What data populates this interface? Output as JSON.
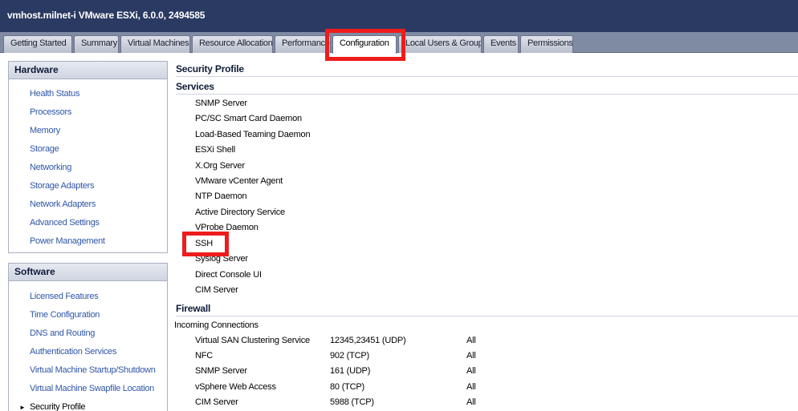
{
  "window": {
    "title": "vmhost.milnet-i VMware ESXi, 6.0.0, 2494585"
  },
  "tabs": [
    {
      "label": "Getting Started"
    },
    {
      "label": "Summary"
    },
    {
      "label": "Virtual Machines"
    },
    {
      "label": "Resource Allocation"
    },
    {
      "label": "Performance"
    },
    {
      "label": "Configuration"
    },
    {
      "label": "Local Users & Groups"
    },
    {
      "label": "Events"
    },
    {
      "label": "Permissions"
    }
  ],
  "active_tab": "Configuration",
  "hardware": {
    "header": "Hardware",
    "items": [
      {
        "label": "Health Status"
      },
      {
        "label": "Processors"
      },
      {
        "label": "Memory"
      },
      {
        "label": "Storage"
      },
      {
        "label": "Networking"
      },
      {
        "label": "Storage Adapters"
      },
      {
        "label": "Network Adapters"
      },
      {
        "label": "Advanced Settings"
      },
      {
        "label": "Power Management"
      }
    ]
  },
  "software": {
    "header": "Software",
    "items": [
      {
        "label": "Licensed Features"
      },
      {
        "label": "Time Configuration"
      },
      {
        "label": "DNS and Routing"
      },
      {
        "label": "Authentication Services"
      },
      {
        "label": "Virtual Machine Startup/Shutdown"
      },
      {
        "label": "Virtual Machine Swapfile Location"
      },
      {
        "label": "Security Profile"
      }
    ]
  },
  "main": {
    "title": "Security Profile",
    "services_heading": "Services",
    "services": [
      {
        "label": "SNMP Server"
      },
      {
        "label": "PC/SC Smart Card Daemon"
      },
      {
        "label": "Load-Based Teaming Daemon"
      },
      {
        "label": "ESXi Shell"
      },
      {
        "label": "X.Org Server"
      },
      {
        "label": "VMware vCenter Agent"
      },
      {
        "label": "NTP Daemon"
      },
      {
        "label": "Active Directory Service"
      },
      {
        "label": "VProbe Daemon"
      },
      {
        "label": "SSH"
      },
      {
        "label": "Syslog Server"
      },
      {
        "label": "Direct Console UI"
      },
      {
        "label": "CIM Server"
      }
    ],
    "firewall_heading": "Firewall",
    "incoming_label": "Incoming Connections",
    "firewall_rows": [
      {
        "name": "Virtual SAN Clustering Service",
        "ports": "12345,23451 (UDP)",
        "scope": "All"
      },
      {
        "name": "NFC",
        "ports": "902 (TCP)",
        "scope": "All"
      },
      {
        "name": "SNMP Server",
        "ports": "161 (UDP)",
        "scope": "All"
      },
      {
        "name": "vSphere Web Access",
        "ports": "80 (TCP)",
        "scope": "All"
      },
      {
        "name": "CIM Server",
        "ports": "5988 (TCP)",
        "scope": "All"
      }
    ]
  },
  "colors": {
    "title_bar": "#2a3a62",
    "link": "#2f56a8",
    "highlight": "#ee1c1c"
  }
}
